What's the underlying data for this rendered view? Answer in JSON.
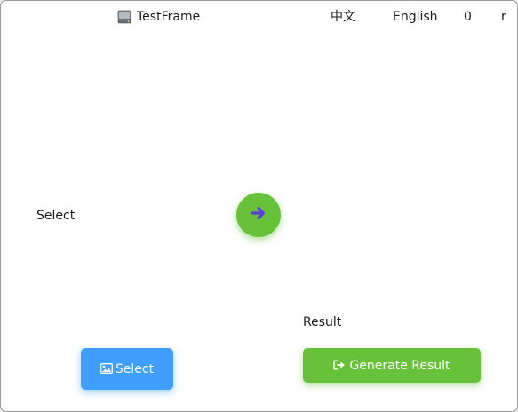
{
  "window": {
    "title": "TestFrame",
    "icon": "drive-icon"
  },
  "menu": {
    "chinese": "中文",
    "english": "English",
    "zero": "0",
    "r": "r"
  },
  "main": {
    "select_label": "Select",
    "result_label": "Result",
    "arrow_icon": "arrow-right-icon",
    "select_button": {
      "label": "Select",
      "icon": "image-icon"
    },
    "generate_button": {
      "label": "Generate Result",
      "icon": "sign-out-icon"
    }
  },
  "colors": {
    "primary": "#409eff",
    "success": "#67c23a",
    "arrow": "#5b3fd6"
  }
}
